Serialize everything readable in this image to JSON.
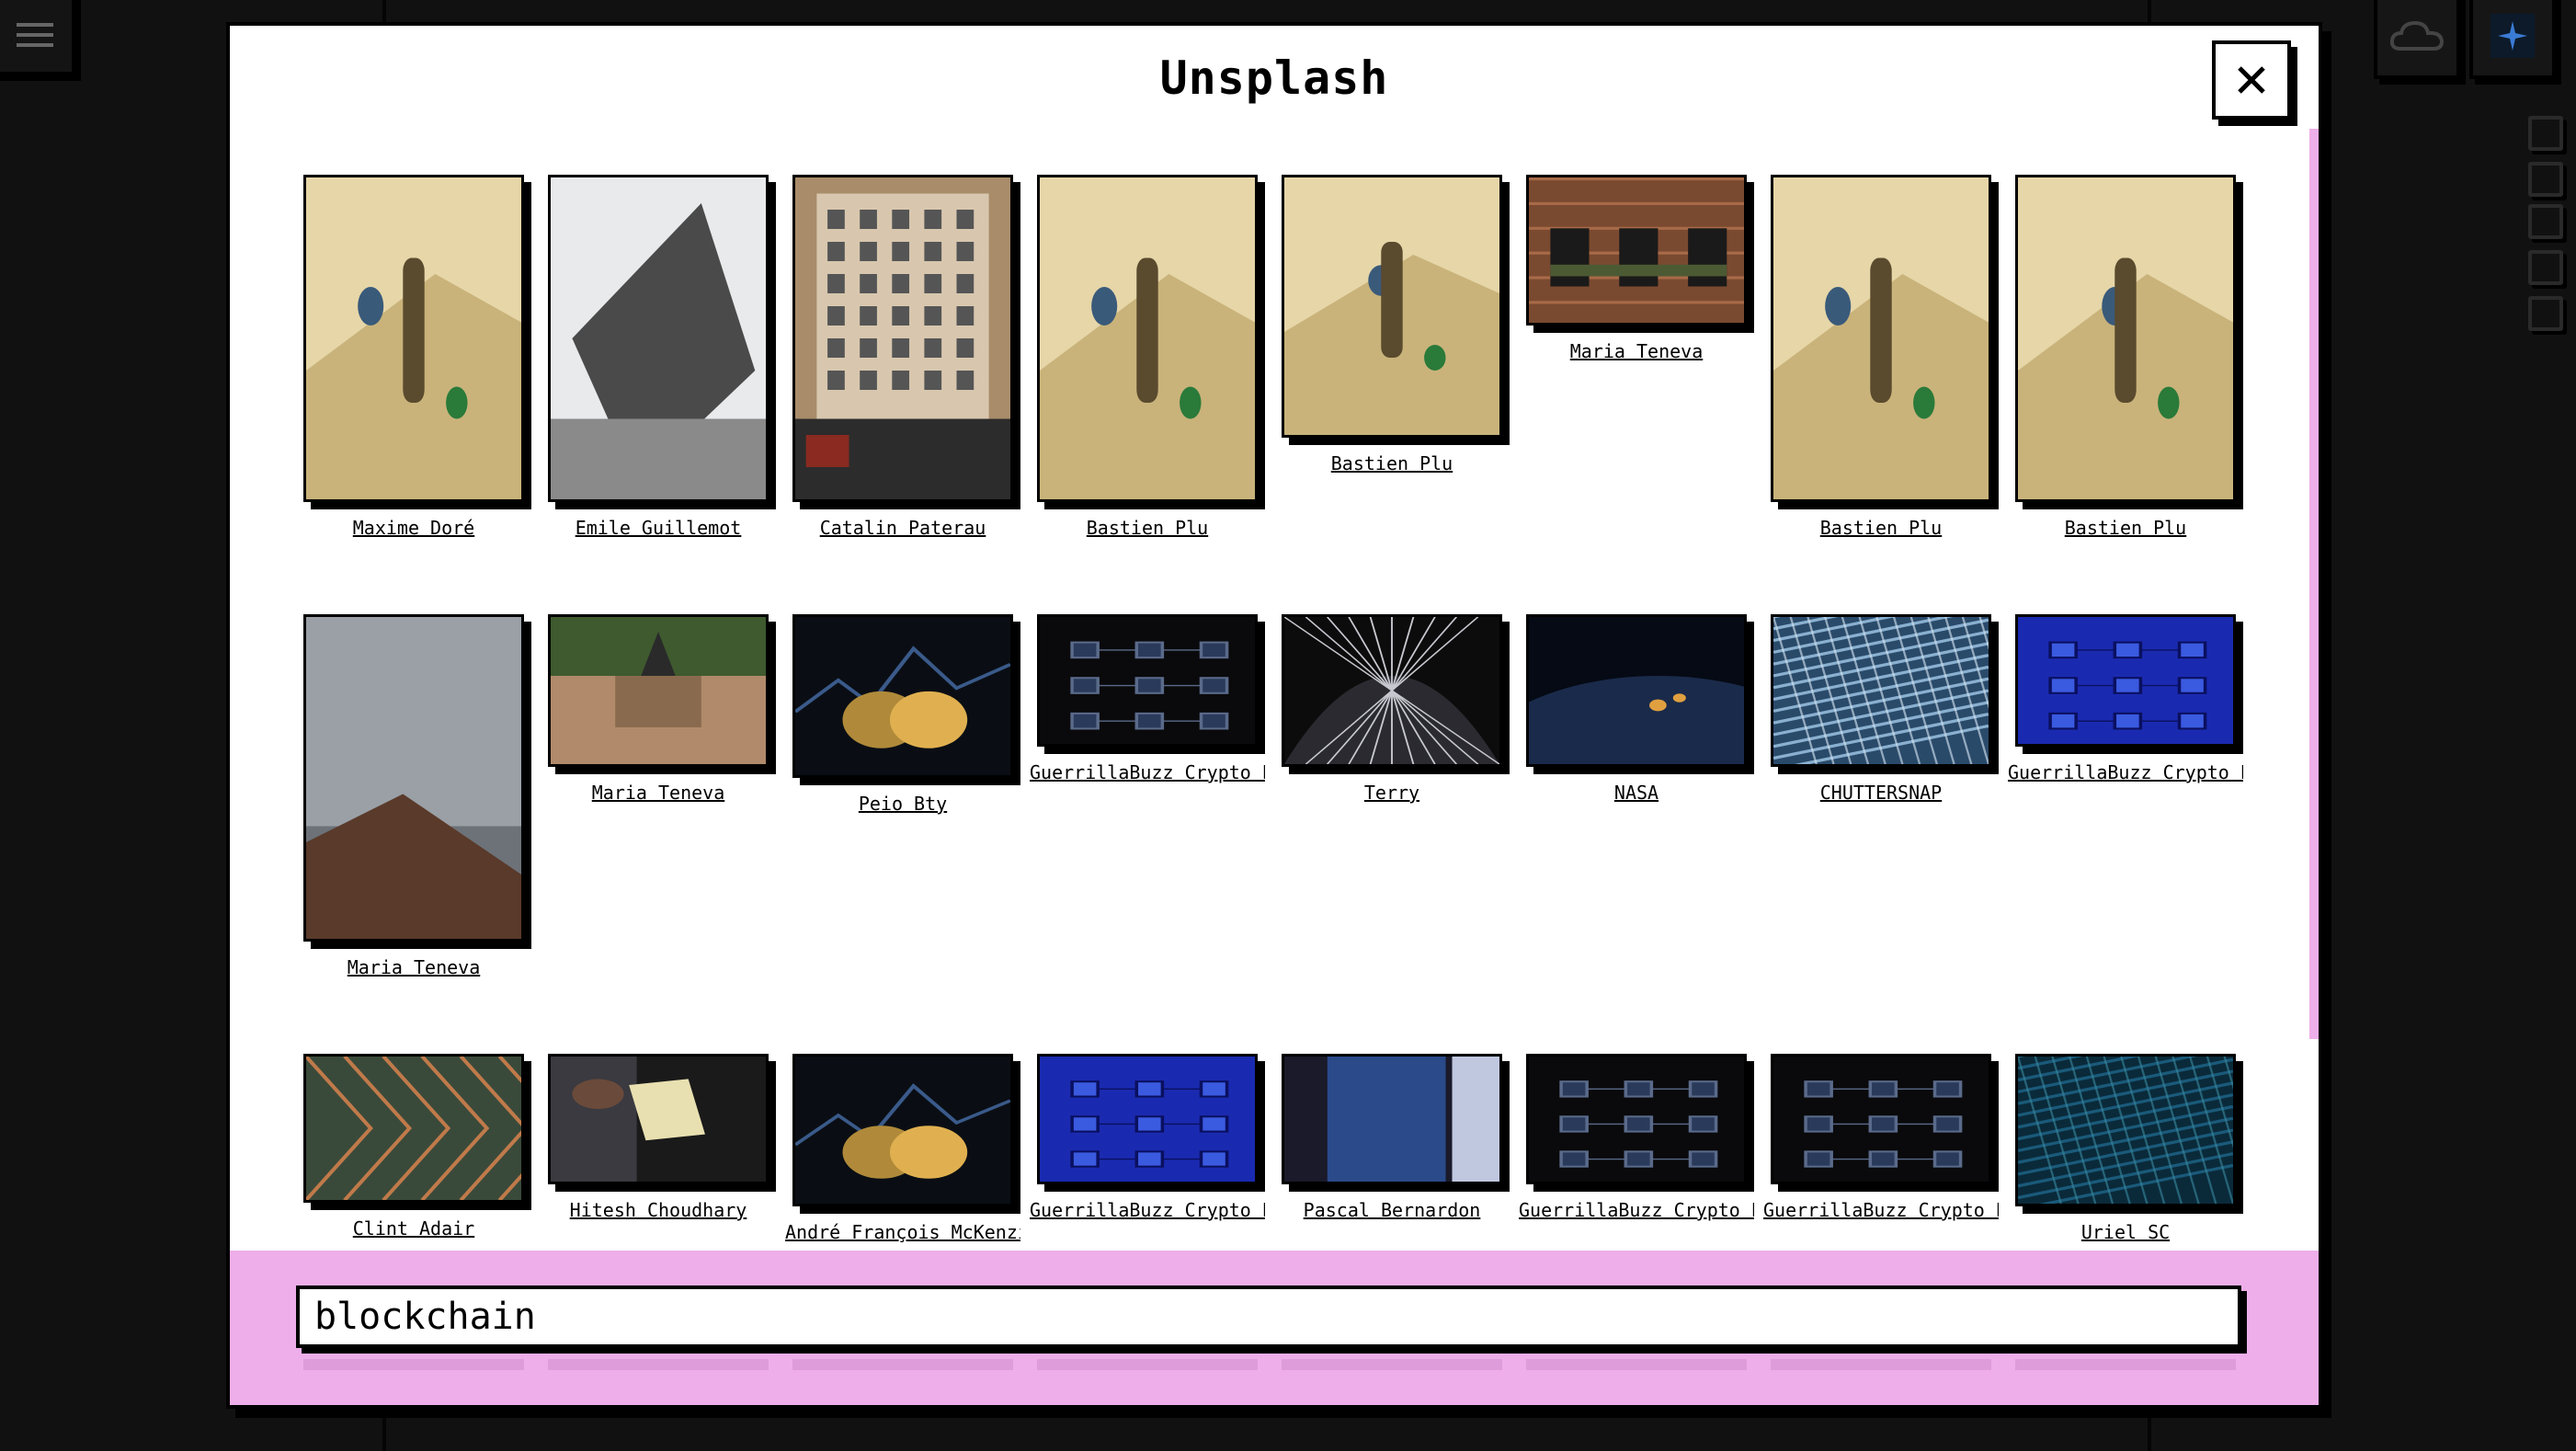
{
  "modal": {
    "title": "Unsplash",
    "close_label": "×"
  },
  "search": {
    "value": "blockchain",
    "placeholder": ""
  },
  "colors": {
    "accent_pink": "#eeaee9",
    "border": "#000000",
    "background": "#111111"
  },
  "photos": [
    {
      "credit": "Maxime Doré",
      "icon": "climbing-photo"
    },
    {
      "credit": "Emile Guillemot",
      "icon": "rock-photo"
    },
    {
      "credit": "Catalin Paterau",
      "icon": "street-photo"
    },
    {
      "credit": "Bastien Plu",
      "icon": "climbing-photo"
    },
    {
      "credit": "Bastien Plu",
      "icon": "climbing-photo"
    },
    {
      "credit": "Maria Teneva",
      "icon": "wall-photo"
    },
    {
      "credit": "Bastien Plu",
      "icon": "climbing-photo"
    },
    {
      "credit": "Bastien Plu",
      "icon": "climbing-photo"
    },
    {
      "credit": "Maria Teneva",
      "icon": "sky-photo"
    },
    {
      "credit": "Maria Teneva",
      "icon": "church-photo"
    },
    {
      "credit": "Peio Bty",
      "icon": "bitcoin-photo"
    },
    {
      "credit": "GuerrillaBuzz Crypto PR",
      "icon": "network-photo"
    },
    {
      "credit": "Terry",
      "icon": "dome-photo"
    },
    {
      "credit": "NASA",
      "icon": "earth-photo"
    },
    {
      "credit": "CHUTTERSNAP",
      "icon": "grid-photo"
    },
    {
      "credit": "GuerrillaBuzz Crypto PR",
      "icon": "cubes-photo"
    },
    {
      "credit": "Clint Adair",
      "icon": "wires-photo"
    },
    {
      "credit": "Hitesh Choudhary",
      "icon": "person-photo"
    },
    {
      "credit": "André François McKenzie",
      "icon": "bitcoin-photo"
    },
    {
      "credit": "GuerrillaBuzz Crypto PR",
      "icon": "cubes-photo"
    },
    {
      "credit": "Pascal Bernardon",
      "icon": "nasdaq-photo"
    },
    {
      "credit": "GuerrillaBuzz Crypto PR",
      "icon": "network-photo"
    },
    {
      "credit": "GuerrillaBuzz Crypto PR",
      "icon": "network-photo"
    },
    {
      "credit": "Uriel SC",
      "icon": "mesh-photo"
    }
  ]
}
